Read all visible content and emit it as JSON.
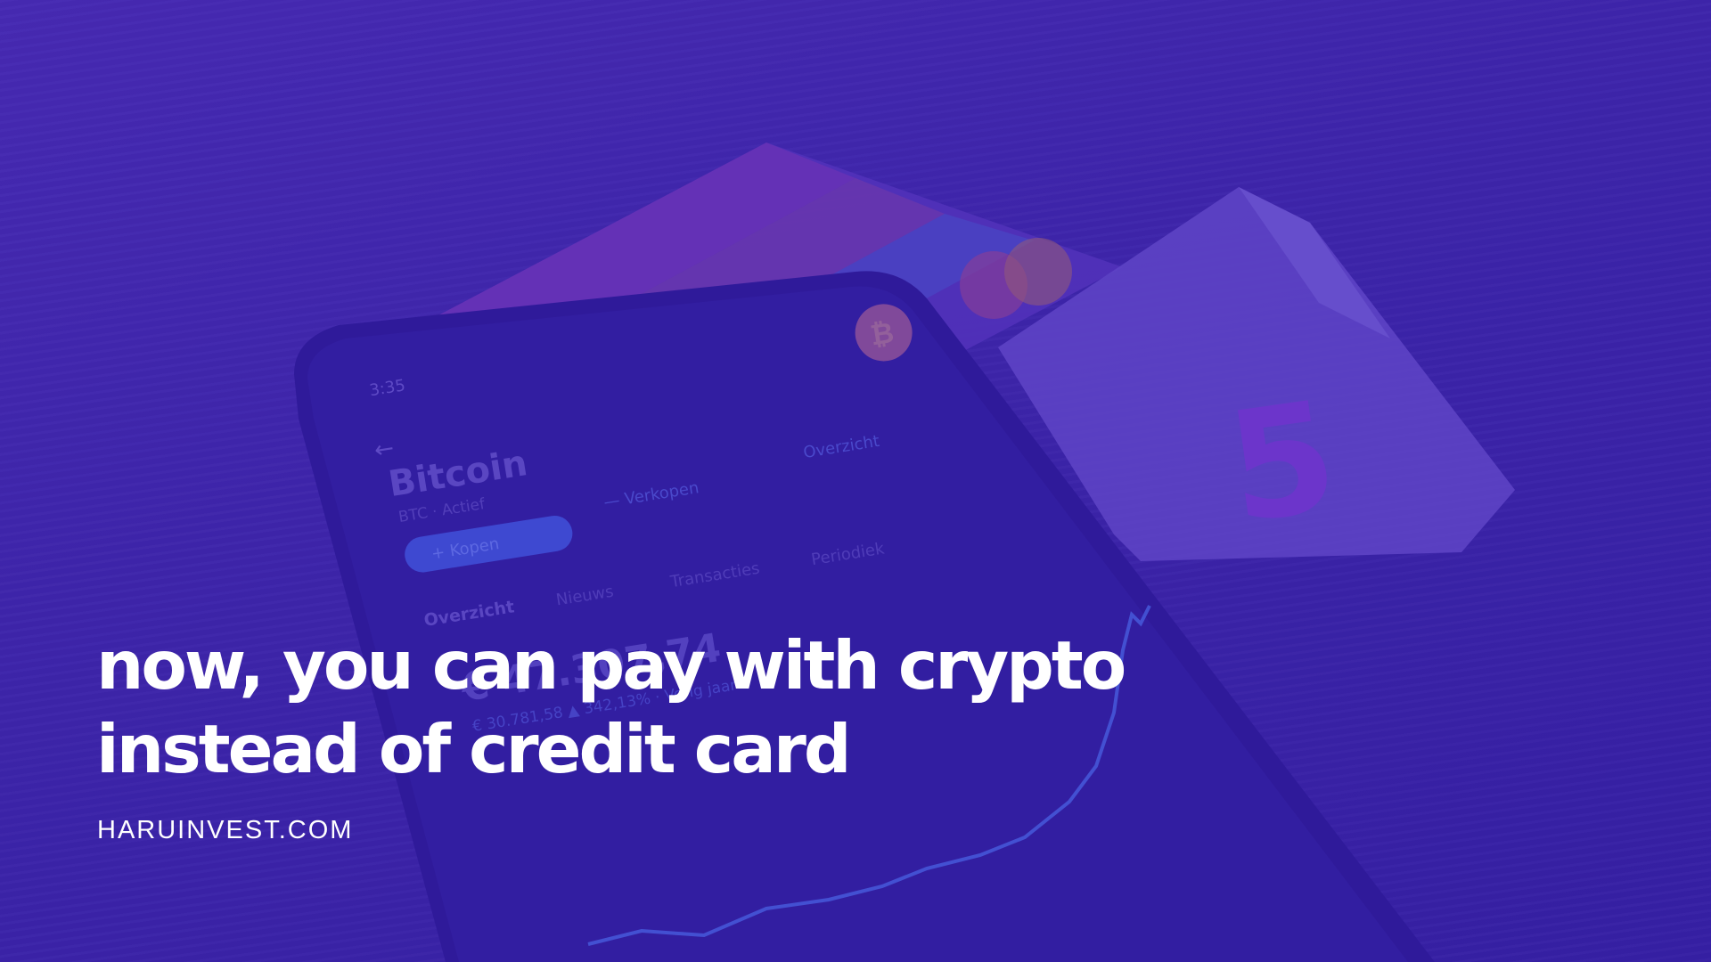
{
  "headline": {
    "line1": "now, you can pay with crypto",
    "line2": "instead of credit card"
  },
  "site": "HARUINVEST.COM",
  "photo": {
    "phone": {
      "time": "3:35",
      "coin_name": "Bitcoin",
      "coin_sub": "BTC · Actief",
      "buy": "+ Kopen",
      "sell": "— Verkopen",
      "overview_chip": "Overzicht",
      "tabs": [
        "Overzicht",
        "Nieuws",
        "Transacties",
        "Periodiek"
      ],
      "price": "€ 47.307,74",
      "change": "€ 30.781,58 ▲ 342,13% · Vorig jaar"
    },
    "banknote_value": "5"
  },
  "colors": {
    "background": "#3f2aa0",
    "overlay": "#3c1ebe",
    "text": "#ffffff",
    "chart_line": "#4f7cf0"
  }
}
